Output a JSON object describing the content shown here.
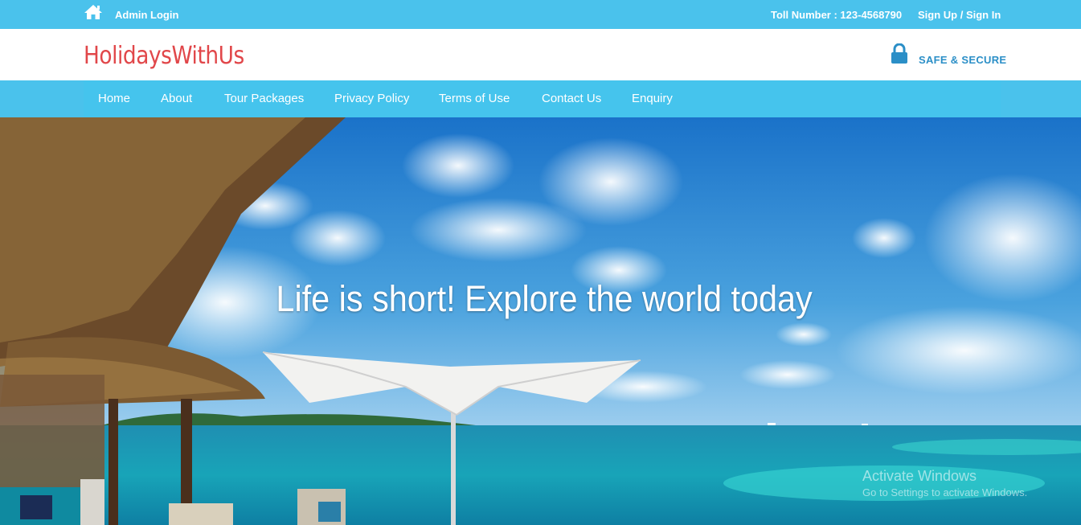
{
  "top_bar": {
    "admin_login": "Admin Login",
    "toll_number": "Toll Number : 123-4568790",
    "signup_signin": "Sign Up / Sign In"
  },
  "header": {
    "brand": "HolidaysWithUs",
    "secure": "SAFE & SECURE"
  },
  "nav": {
    "items": [
      {
        "label": "Home"
      },
      {
        "label": "About"
      },
      {
        "label": "Tour Packages"
      },
      {
        "label": "Privacy Policy"
      },
      {
        "label": "Terms of Use"
      },
      {
        "label": "Contact Us"
      },
      {
        "label": "Enquiry"
      }
    ]
  },
  "hero": {
    "title": "Life is short! Explore the world today"
  },
  "watermark": {
    "title": "Activate Windows",
    "subtitle": "Go to Settings to activate Windows."
  },
  "colors": {
    "accent_blue": "#4ac2ec",
    "brand_red": "#e1474a",
    "secure_blue": "#2b8fc7"
  },
  "icons": {
    "home": "home-icon",
    "lock": "lock-icon"
  }
}
